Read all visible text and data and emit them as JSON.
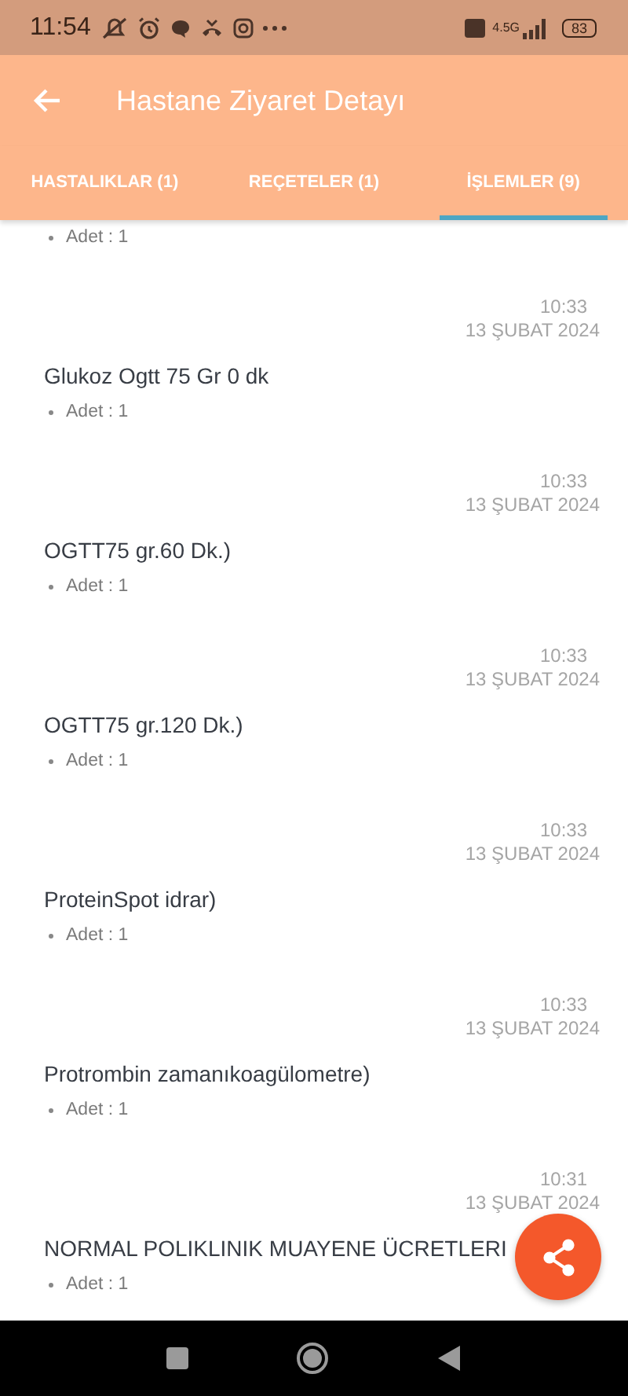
{
  "status_bar": {
    "time": "11:54",
    "network": "4.5G",
    "battery": "83"
  },
  "app_bar": {
    "title": "Hastane Ziyaret Detayı"
  },
  "tabs": [
    {
      "label": "HASTALIKLAR (1)",
      "selected": false
    },
    {
      "label": "REÇETELER (1)",
      "selected": false
    },
    {
      "label": "İŞLEMLER (9)",
      "selected": true
    }
  ],
  "procedures": [
    {
      "amount": "Adet : 1"
    },
    {
      "time": "10:33",
      "date": "13 ŞUBAT 2024",
      "name": "Glukoz Ogtt 75 Gr 0 dk",
      "amount": "Adet : 1"
    },
    {
      "time": "10:33",
      "date": "13 ŞUBAT 2024",
      "name": "OGTT75 gr.60 Dk.)",
      "amount": "Adet : 1"
    },
    {
      "time": "10:33",
      "date": "13 ŞUBAT 2024",
      "name": "OGTT75 gr.120 Dk.)",
      "amount": "Adet : 1"
    },
    {
      "time": "10:33",
      "date": "13 ŞUBAT 2024",
      "name": "ProteinSpot idrar)",
      "amount": "Adet : 1"
    },
    {
      "time": "10:33",
      "date": "13 ŞUBAT 2024",
      "name": "Protrombin zamanıkoagülometre)",
      "amount": "Adet : 1"
    },
    {
      "time": "10:31",
      "date": "13 ŞUBAT 2024",
      "name": "NORMAL POLIKLINIK MUAYENE ÜCRETLERI",
      "amount": "Adet : 1"
    }
  ]
}
